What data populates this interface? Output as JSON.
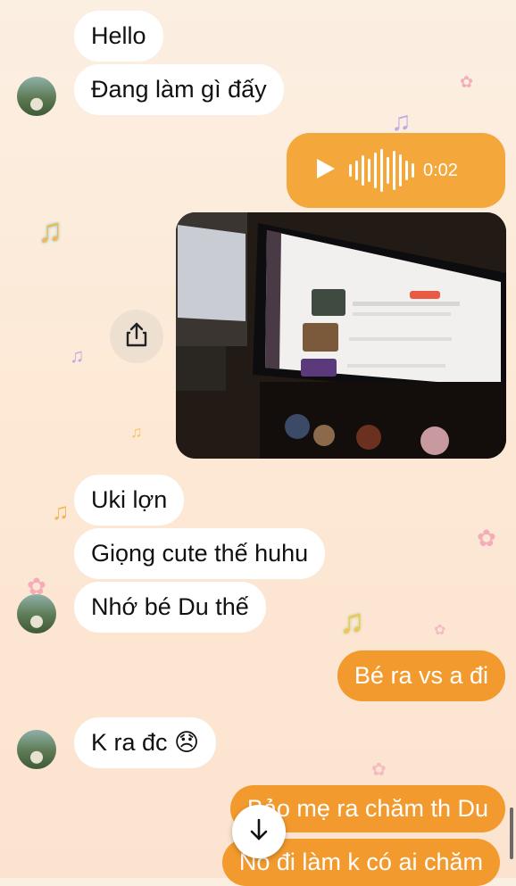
{
  "messages": [
    {
      "id": "m1",
      "text": "Hello"
    },
    {
      "id": "m2",
      "text": "Đang làm gì đấy"
    },
    {
      "id": "m3",
      "text": "Uki lợn"
    },
    {
      "id": "m4",
      "text": "Giọng cute thế huhu"
    },
    {
      "id": "m5",
      "text": "Nhớ bé Du thế"
    },
    {
      "id": "m6",
      "text": "Bé ra vs a đi"
    },
    {
      "id": "m7",
      "text": "K ra đc 😞"
    },
    {
      "id": "m8",
      "text": "Bảo mẹ ra chăm th Du"
    },
    {
      "id": "m9",
      "text": "Nó đi làm k có ai chăm"
    }
  ],
  "voice_message": {
    "duration": "0:02"
  },
  "icons": {
    "voice_play": "play-icon",
    "share": "share-icon",
    "scroll": "arrow-down-icon",
    "decor": [
      "music-note-icon",
      "flower-icon"
    ]
  },
  "colors": {
    "outgoing": "#f39a2e",
    "voice_bubble": "#f4a73a",
    "incoming": "#ffffff",
    "background": "#fbefe2"
  }
}
